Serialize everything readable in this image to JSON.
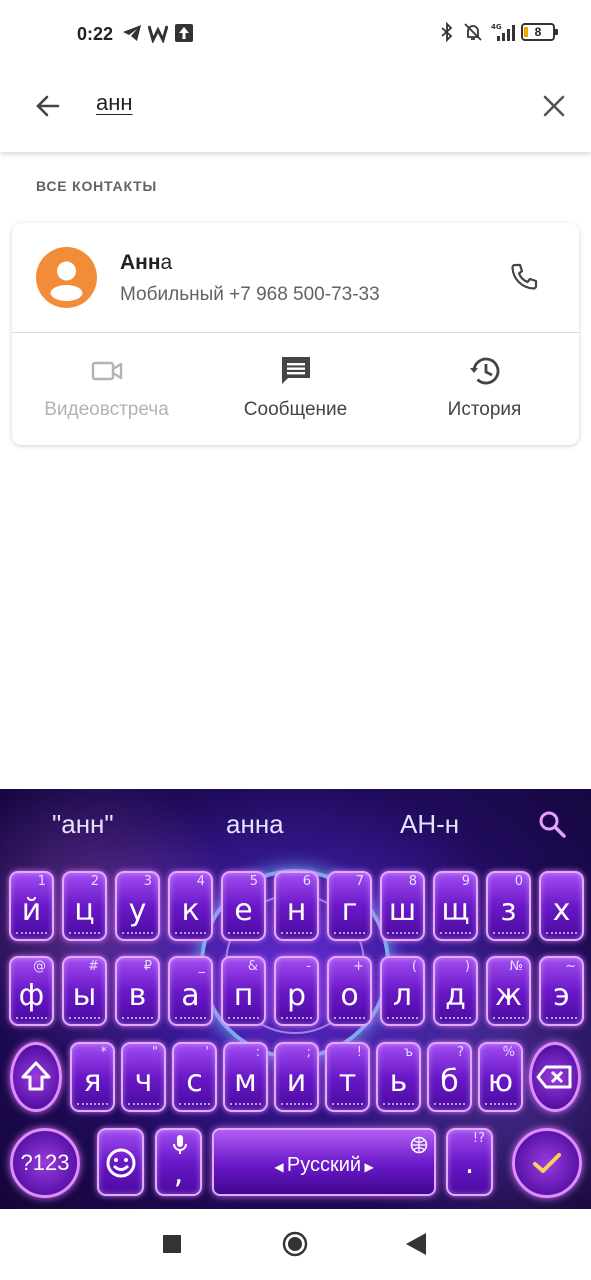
{
  "status_bar": {
    "time": "0:22",
    "left_icons": [
      "telegram-icon",
      "w-app-icon",
      "upload-icon"
    ],
    "right_icons": [
      "bluetooth-icon",
      "silent-bell-icon",
      "signal-4g-icon"
    ],
    "signal_label": "4G",
    "battery": "8"
  },
  "search": {
    "query": "анн"
  },
  "section": {
    "title": "ВСЕ КОНТАКТЫ"
  },
  "contact": {
    "name_match": "Анн",
    "name_rest": "а",
    "detail": "Мобильный +7 968 500-73-33",
    "avatar_color": "#f28c38"
  },
  "actions": [
    {
      "label": "Видеовстреча",
      "icon": "video-icon",
      "enabled": false
    },
    {
      "label": "Сообщение",
      "icon": "message-icon",
      "enabled": true
    },
    {
      "label": "История",
      "icon": "history-icon",
      "enabled": true
    }
  ],
  "keyboard": {
    "suggestions": [
      "\"анн\"",
      "анна",
      "АН-н"
    ],
    "row1": [
      {
        "k": "й",
        "h": "1"
      },
      {
        "k": "ц",
        "h": "2"
      },
      {
        "k": "у",
        "h": "3"
      },
      {
        "k": "к",
        "h": "4"
      },
      {
        "k": "е",
        "h": "5"
      },
      {
        "k": "н",
        "h": "6"
      },
      {
        "k": "г",
        "h": "7"
      },
      {
        "k": "ш",
        "h": "8"
      },
      {
        "k": "щ",
        "h": "9"
      },
      {
        "k": "з",
        "h": "0"
      },
      {
        "k": "х",
        "h": ""
      }
    ],
    "row2": [
      {
        "k": "ф",
        "h": "@"
      },
      {
        "k": "ы",
        "h": "#"
      },
      {
        "k": "в",
        "h": "₽"
      },
      {
        "k": "а",
        "h": "_"
      },
      {
        "k": "п",
        "h": "&"
      },
      {
        "k": "р",
        "h": "-"
      },
      {
        "k": "о",
        "h": "+"
      },
      {
        "k": "л",
        "h": "("
      },
      {
        "k": "д",
        "h": ")"
      },
      {
        "k": "ж",
        "h": "№"
      },
      {
        "k": "э",
        "h": "~"
      }
    ],
    "row3": [
      {
        "k": "я",
        "h": "*"
      },
      {
        "k": "ч",
        "h": "\""
      },
      {
        "k": "с",
        "h": "'"
      },
      {
        "k": "м",
        "h": ":"
      },
      {
        "k": "и",
        "h": ";"
      },
      {
        "k": "т",
        "h": "!"
      },
      {
        "k": "ь",
        "h": "ъ"
      },
      {
        "k": "б",
        "h": "?"
      },
      {
        "k": "ю",
        "h": "%"
      }
    ],
    "symbols_label": "?123",
    "comma_hint": ",",
    "space_label": "Русский",
    "period_hint": "!?",
    "period_label": ".",
    "accent_color": "#e3a8ff"
  },
  "navbar": {
    "icons": [
      "recents-square-icon",
      "home-circle-icon",
      "back-triangle-icon"
    ]
  }
}
